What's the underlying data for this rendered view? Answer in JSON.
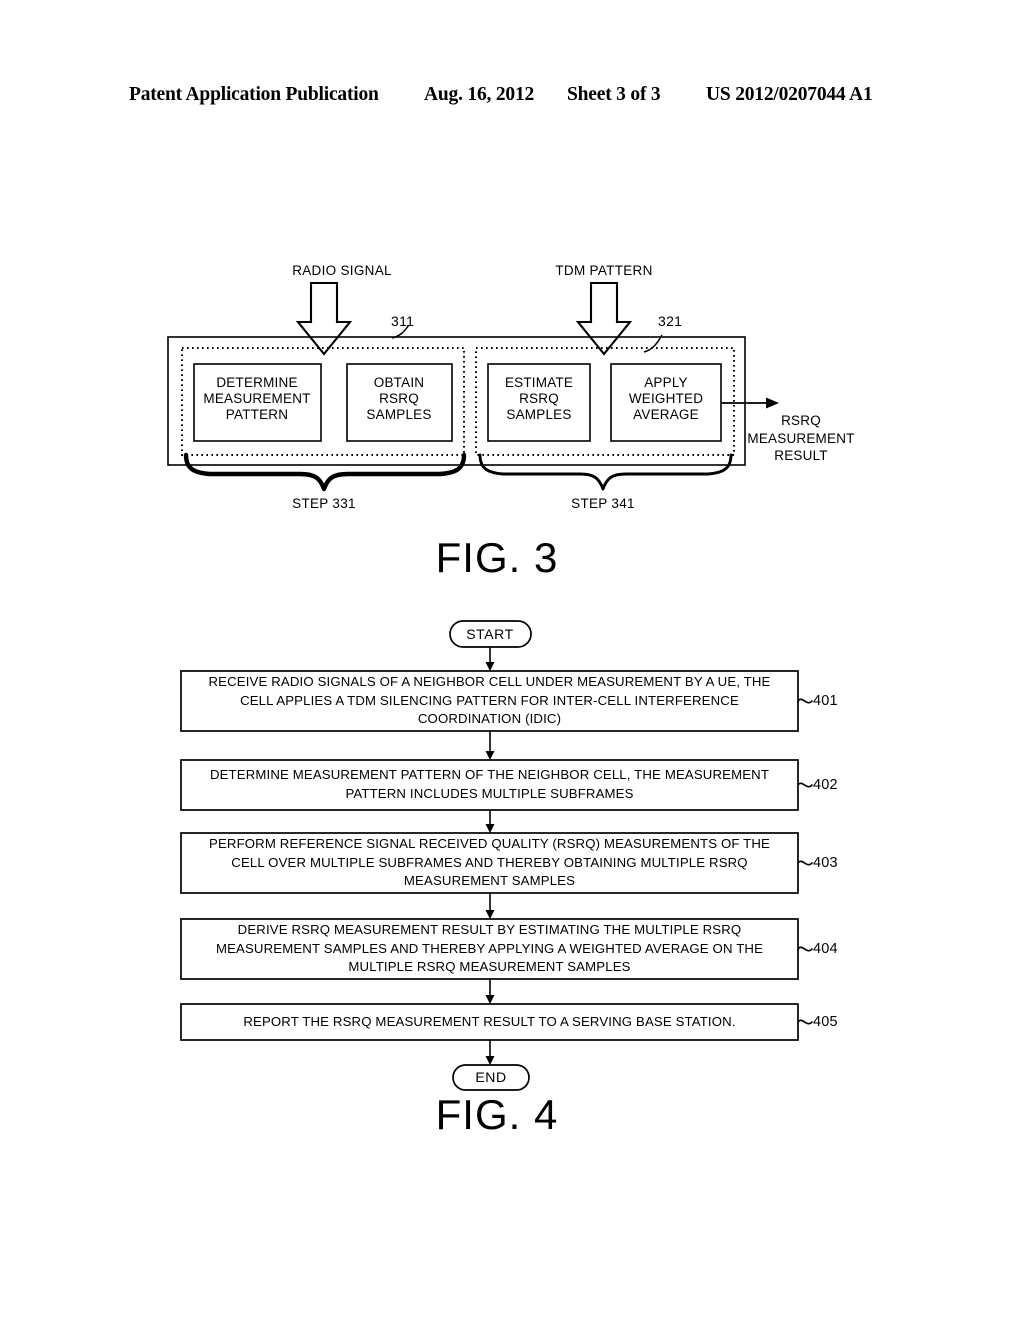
{
  "header": {
    "publication": "Patent Application Publication",
    "date": "Aug. 16, 2012",
    "sheet": "Sheet 3 of 3",
    "number": "US 2012/0207044 A1"
  },
  "figure3": {
    "title": "FIG. 3",
    "inputs": [
      {
        "label": "RADIO SIGNAL"
      },
      {
        "label": "TDM PATTERN"
      }
    ],
    "group_refs": [
      {
        "label": "311"
      },
      {
        "label": "321"
      }
    ],
    "blocks": [
      {
        "lines": "DETERMINE\nMEASUREMENT\nPATTERN"
      },
      {
        "lines": "OBTAIN\nRSRQ\nSAMPLES"
      },
      {
        "lines": "ESTIMATE\nRSRQ\nSAMPLES"
      },
      {
        "lines": "APPLY\nWEIGHTED\nAVERAGE"
      }
    ],
    "braces": [
      {
        "label": "STEP 331"
      },
      {
        "label": "STEP 341"
      }
    ],
    "output": {
      "lines": "RSRQ\nMEASUREMENT\nRESULT"
    }
  },
  "figure4": {
    "title": "FIG. 4",
    "start": "START",
    "end": "END",
    "steps": [
      {
        "ref": "401",
        "text": "RECEIVE RADIO SIGNALS OF A NEIGHBOR CELL UNDER MEASUREMENT BY A UE, THE CELL APPLIES A TDM SILENCING PATTERN FOR INTER-CELL INTERFERENCE COORDINATION (IDIC)"
      },
      {
        "ref": "402",
        "text": "DETERMINE MEASUREMENT PATTERN OF THE NEIGHBOR CELL, THE MEASUREMENT PATTERN INCLUDES MULTIPLE SUBFRAMES"
      },
      {
        "ref": "403",
        "text": "PERFORM REFERENCE SIGNAL RECEIVED QUALITY (RSRQ) MEASUREMENTS OF THE CELL OVER MULTIPLE SUBFRAMES AND THEREBY OBTAINING MULTIPLE RSRQ MEASUREMENT SAMPLES"
      },
      {
        "ref": "404",
        "text": "DERIVE RSRQ MEASUREMENT RESULT BY ESTIMATING THE MULTIPLE RSRQ MEASUREMENT SAMPLES AND THEREBY APPLYING A WEIGHTED AVERAGE ON THE MULTIPLE RSRQ MEASUREMENT SAMPLES"
      },
      {
        "ref": "405",
        "text": "REPORT THE RSRQ MEASUREMENT RESULT TO A SERVING BASE STATION."
      }
    ]
  }
}
